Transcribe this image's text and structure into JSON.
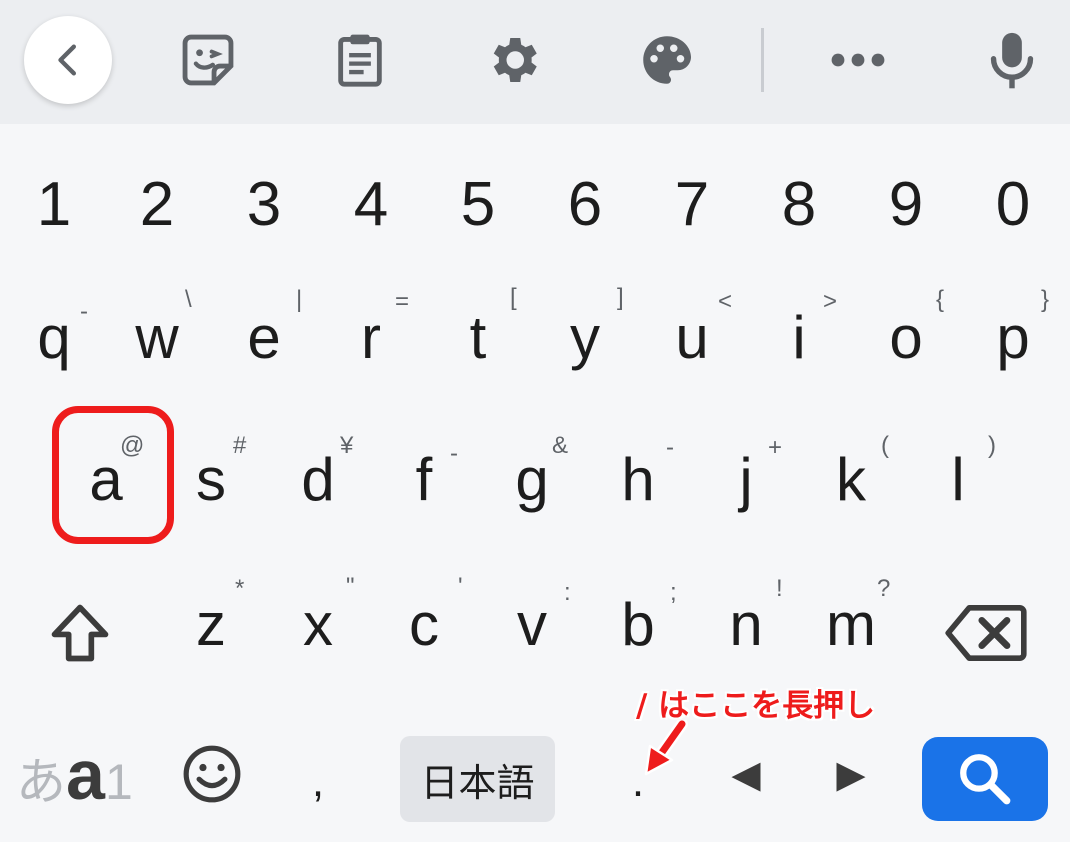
{
  "toolbar": {
    "icons": [
      "chevron-left-icon",
      "sticker-icon",
      "clipboard-icon",
      "gear-icon",
      "palette-icon",
      "more-horizontal-icon",
      "microphone-icon"
    ]
  },
  "keyboard": {
    "numbers": [
      "1",
      "2",
      "3",
      "4",
      "5",
      "6",
      "7",
      "8",
      "9",
      "0"
    ],
    "row1": [
      {
        "key": "q",
        "hint": "-"
      },
      {
        "key": "w",
        "hint": "\\"
      },
      {
        "key": "e",
        "hint": "|"
      },
      {
        "key": "r",
        "hint": "="
      },
      {
        "key": "t",
        "hint": "["
      },
      {
        "key": "y",
        "hint": "]"
      },
      {
        "key": "u",
        "hint": "<"
      },
      {
        "key": "i",
        "hint": ">"
      },
      {
        "key": "o",
        "hint": "{"
      },
      {
        "key": "p",
        "hint": "}"
      }
    ],
    "row2": [
      {
        "key": "a",
        "hint": "@"
      },
      {
        "key": "s",
        "hint": "#"
      },
      {
        "key": "d",
        "hint": "¥"
      },
      {
        "key": "f",
        "hint": "-"
      },
      {
        "key": "g",
        "hint": "&"
      },
      {
        "key": "h",
        "hint": "-"
      },
      {
        "key": "j",
        "hint": "+"
      },
      {
        "key": "k",
        "hint": "("
      },
      {
        "key": "l",
        "hint": ")"
      }
    ],
    "row3": [
      {
        "key": "z",
        "hint": "*"
      },
      {
        "key": "x",
        "hint": "\""
      },
      {
        "key": "c",
        "hint": "'"
      },
      {
        "key": "v",
        "hint": ":"
      },
      {
        "key": "b",
        "hint": ";"
      },
      {
        "key": "n",
        "hint": "!"
      },
      {
        "key": "m",
        "hint": "?"
      }
    ],
    "bottom": {
      "mode_hiragana": "あ",
      "mode_alpha": "a",
      "mode_number": "1",
      "comma": ",",
      "language": "日本語",
      "period": ".",
      "left_arrow": "◀",
      "right_arrow": "▶"
    }
  },
  "annotation": {
    "text": "/ はここを長押し",
    "color": "#ee1c1c"
  },
  "colors": {
    "accent": "#1a73e8",
    "highlight": "#ee1c1c",
    "icon": "#5f6368"
  }
}
